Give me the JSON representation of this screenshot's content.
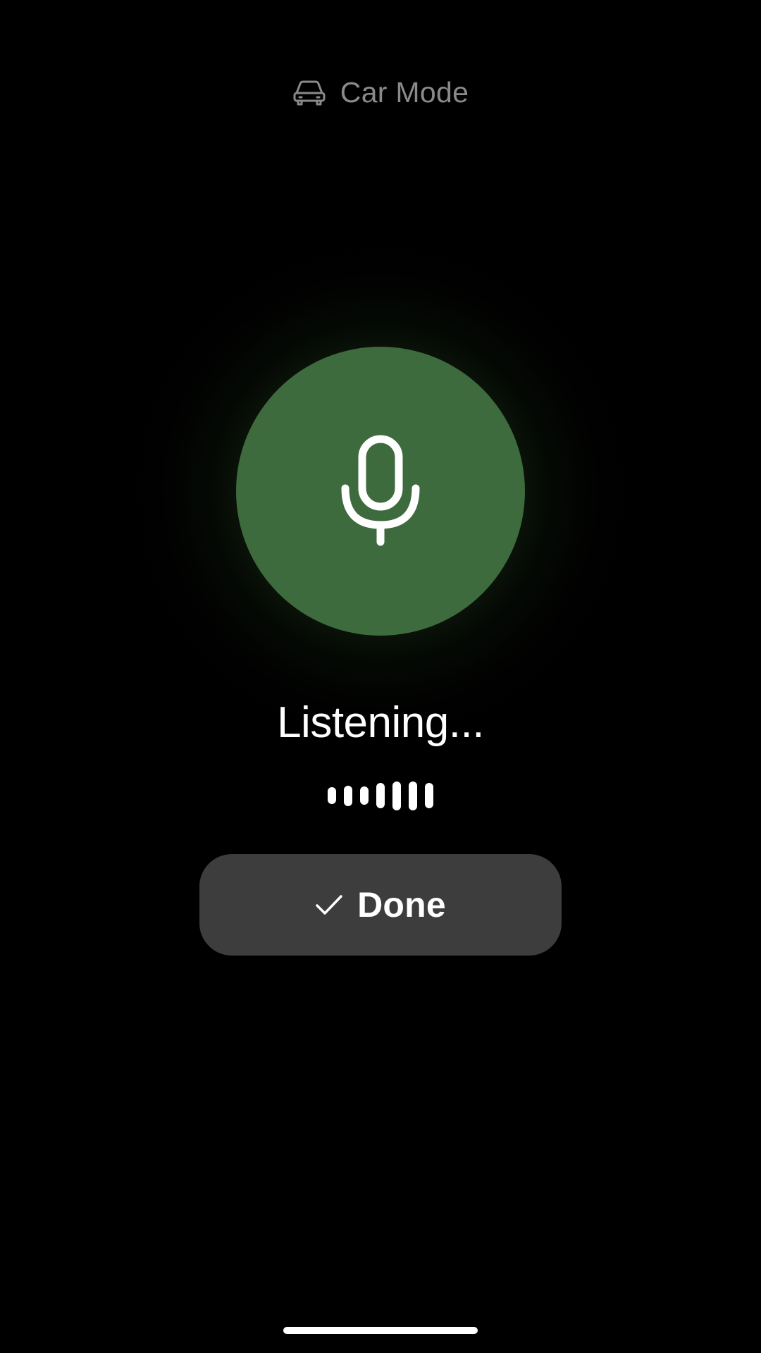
{
  "header": {
    "icon": "car-icon",
    "title": "Car Mode"
  },
  "mic": {
    "icon": "microphone-icon",
    "color": "#3e6b3d"
  },
  "status": {
    "text": "Listening..."
  },
  "waveform": {
    "icon": "audio-waveform",
    "bar_levels": [
      0.5,
      0.6,
      0.55,
      0.75,
      0.85,
      0.85,
      0.75
    ]
  },
  "done_button": {
    "icon": "check-icon",
    "label": "Done",
    "color": "#3d3d3d"
  },
  "home_indicator": {
    "icon": "home-indicator-bar"
  }
}
